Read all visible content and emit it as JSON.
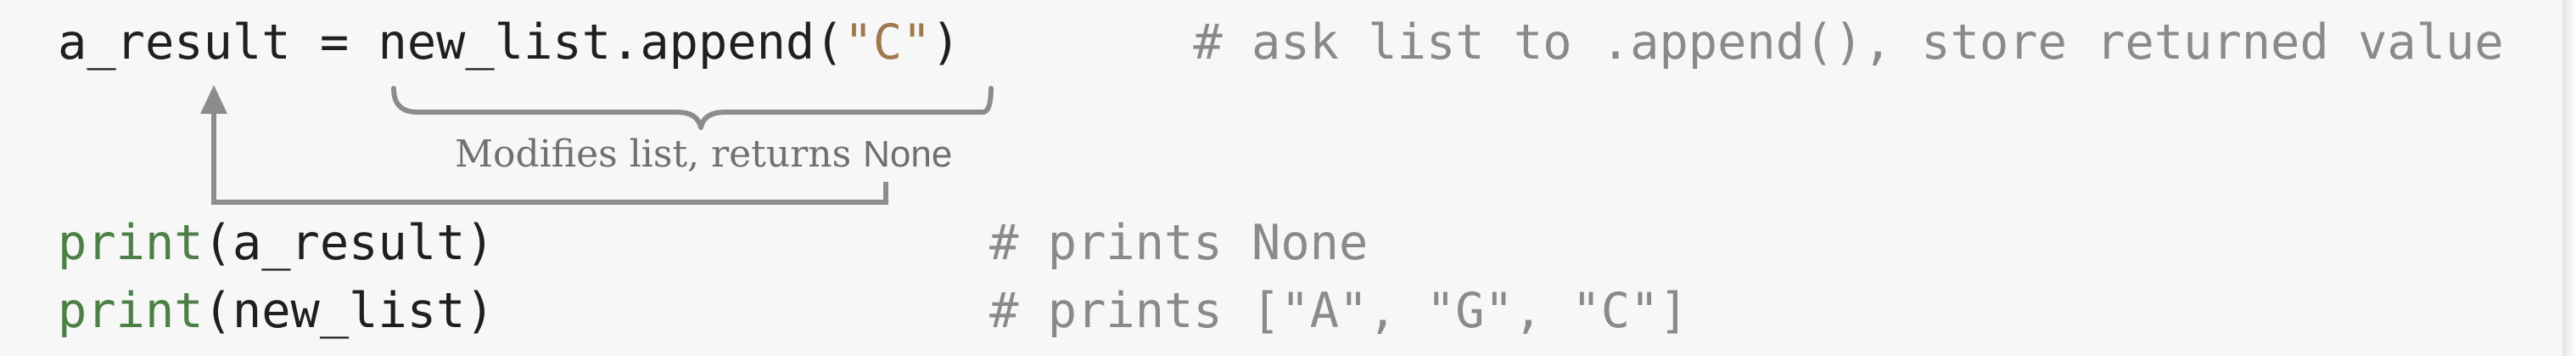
{
  "code": {
    "line1": {
      "variable": "a_result",
      "assign": " = ",
      "call": "new_list.append(",
      "arg": "\"C\"",
      "close": ")",
      "comment": "# ask list to .append(), store returned value"
    },
    "line2": {
      "func": "print",
      "args": "(a_result)",
      "comment": "# prints None"
    },
    "line3": {
      "func": "print",
      "args": "(new_list)",
      "comment": "# prints [\"A\", \"G\", \"C\"]"
    }
  },
  "annotation": {
    "text": "Modifies list, returns ",
    "code": "None"
  },
  "colors": {
    "background": "#f7f7f7",
    "code_text": "#1f1f1f",
    "function": "#4c8046",
    "string": "#a07a4e",
    "comment": "#8a8a8a",
    "annotation": "#8c8c8c"
  }
}
